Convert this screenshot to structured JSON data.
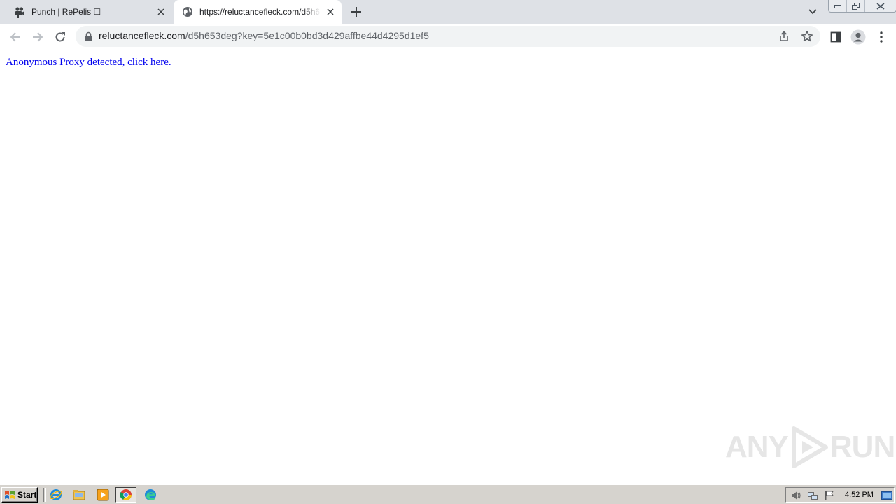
{
  "browser": {
    "tabs": [
      {
        "title": "Punch | RePelis ☐",
        "icon": "movie-camera-icon",
        "active": false
      },
      {
        "title": "https://reluctancefleck.com/d5h653deg?key=5e1c00b0bd3d429affbe44d4295d1ef5",
        "icon": "globe-icon",
        "active": true
      }
    ],
    "new_tab_icon": "plus-icon",
    "tab_search_icon": "chevron-down-icon"
  },
  "toolbar": {
    "url_host": "reluctancefleck.com",
    "url_path": "/d5h653deg?key=5e1c00b0bd3d429affbe44d4295d1ef5",
    "lock_icon": "lock-icon"
  },
  "page": {
    "link_text": "Anonymous Proxy detected, click here."
  },
  "watermark": {
    "left": "ANY",
    "right": "RUN"
  },
  "taskbar": {
    "start_label": "Start",
    "clock": "4:52 PM"
  },
  "colors": {
    "tabstrip": "#dee1e6",
    "omnibox": "#f1f3f4",
    "link": "#0000ee",
    "taskbar": "#d6d3ce"
  }
}
